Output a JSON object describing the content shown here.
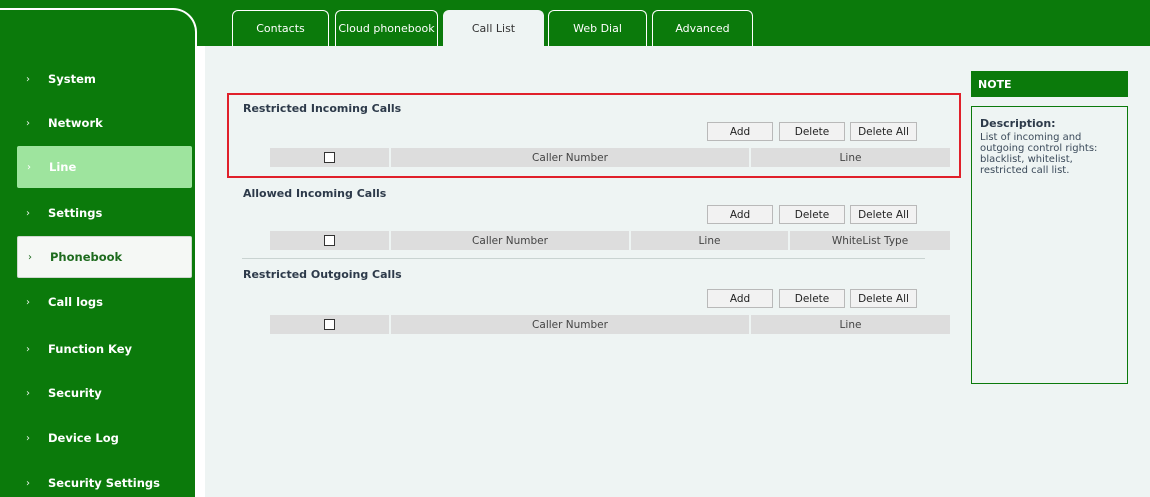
{
  "tabs": [
    {
      "label": "Contacts"
    },
    {
      "label": "Cloud phonebook"
    },
    {
      "label": "Call List"
    },
    {
      "label": "Web Dial"
    },
    {
      "label": "Advanced"
    }
  ],
  "sidebar": {
    "items": [
      {
        "label": "System"
      },
      {
        "label": "Network"
      },
      {
        "label": "Line"
      },
      {
        "label": "Settings"
      },
      {
        "label": "Phonebook"
      },
      {
        "label": "Call logs"
      },
      {
        "label": "Function Key"
      },
      {
        "label": "Security"
      },
      {
        "label": "Device Log"
      },
      {
        "label": "Security Settings"
      }
    ],
    "chevron": "›"
  },
  "sections": [
    {
      "title": "Restricted Incoming Calls",
      "buttons": {
        "add": "Add",
        "delete": "Delete",
        "delete_all": "Delete All"
      },
      "columns": [
        "Caller Number",
        "Line"
      ]
    },
    {
      "title": "Allowed Incoming Calls",
      "buttons": {
        "add": "Add",
        "delete": "Delete",
        "delete_all": "Delete All"
      },
      "columns": [
        "Caller Number",
        "Line",
        "WhiteList Type"
      ]
    },
    {
      "title": "Restricted Outgoing Calls",
      "buttons": {
        "add": "Add",
        "delete": "Delete",
        "delete_all": "Delete All"
      },
      "columns": [
        "Caller Number",
        "Line"
      ]
    }
  ],
  "note": {
    "header": "NOTE",
    "title": "Description:",
    "text": "List of incoming and outgoing control rights: blacklist,  whitelist, restricted call list."
  },
  "colors": {
    "brand_green": "#0b7a0b",
    "active_line_bg": "#9ee49e",
    "content_bg": "#eef4f3",
    "highlight_red": "#e0202a"
  }
}
